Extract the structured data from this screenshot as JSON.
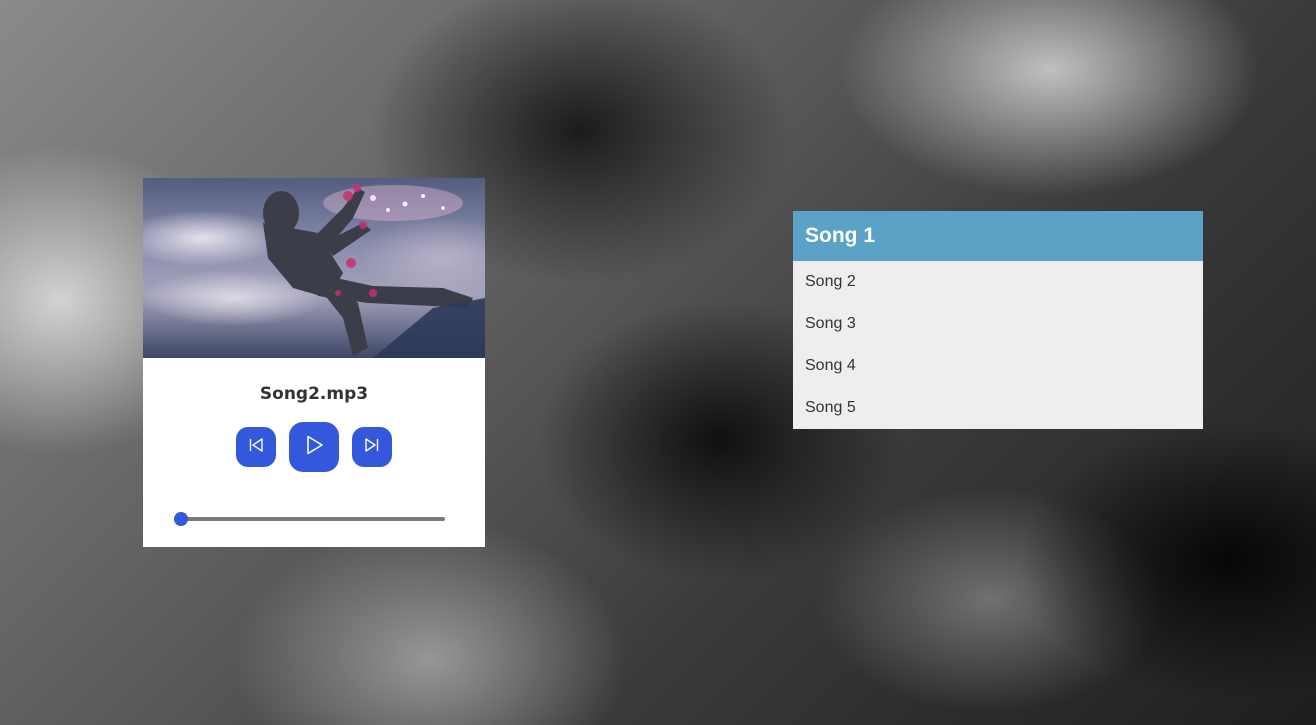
{
  "player": {
    "track_name": "Song2.mp3",
    "progress": 0.0,
    "accent_color": "#3358dc",
    "controls": {
      "prev_icon": "skip-back-icon",
      "play_icon": "play-icon",
      "next_icon": "skip-forward-icon"
    },
    "cover_art": "armored-warrior-artwork"
  },
  "playlist": {
    "active_color": "#5ba2c6",
    "items": [
      {
        "label": "Song 1",
        "active": true
      },
      {
        "label": "Song 2",
        "active": false
      },
      {
        "label": "Song 3",
        "active": false
      },
      {
        "label": "Song 4",
        "active": false
      },
      {
        "label": "Song 5",
        "active": false
      }
    ]
  }
}
